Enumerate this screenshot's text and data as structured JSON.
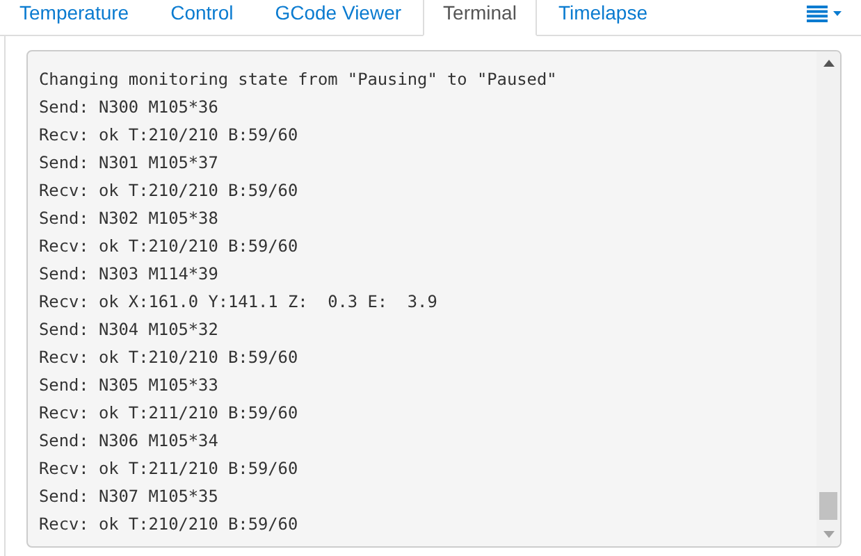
{
  "tabs": [
    {
      "label": "Temperature",
      "selected": false
    },
    {
      "label": "Control",
      "selected": false
    },
    {
      "label": "GCode Viewer",
      "selected": false
    },
    {
      "label": "Terminal",
      "selected": true
    },
    {
      "label": "Timelapse",
      "selected": false
    }
  ],
  "terminal": {
    "lines": [
      "Changing monitoring state from \"Pausing\" to \"Paused\"",
      "Send: N300 M105*36",
      "Recv: ok T:210/210 B:59/60",
      "Send: N301 M105*37",
      "Recv: ok T:210/210 B:59/60",
      "Send: N302 M105*38",
      "Recv: ok T:210/210 B:59/60",
      "Send: N303 M114*39",
      "Recv: ok X:161.0 Y:141.1 Z:  0.3 E:  3.9",
      "Send: N304 M105*32",
      "Recv: ok T:210/210 B:59/60",
      "Send: N305 M105*33",
      "Recv: ok T:211/210 B:59/60",
      "Send: N306 M105*34",
      "Recv: ok T:211/210 B:59/60",
      "Send: N307 M105*35",
      "Recv: ok T:210/210 B:59/60"
    ]
  }
}
